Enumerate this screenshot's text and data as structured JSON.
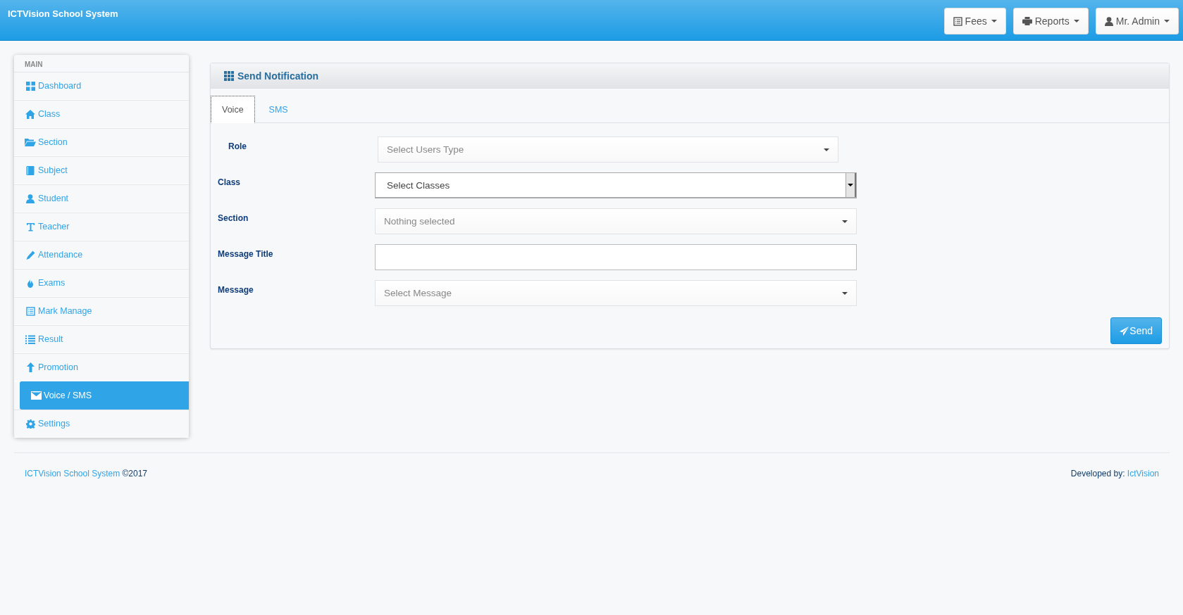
{
  "header": {
    "title": "ICTVision School System",
    "menus": [
      {
        "label": "Fees"
      },
      {
        "label": "Reports"
      },
      {
        "label": "Mr. Admin"
      }
    ]
  },
  "sidebar": {
    "heading": "MAIN",
    "items": [
      {
        "label": "Dashboard",
        "selected": false
      },
      {
        "label": "Class",
        "selected": false
      },
      {
        "label": "Section",
        "selected": false
      },
      {
        "label": "Subject",
        "selected": false
      },
      {
        "label": "Student",
        "selected": false
      },
      {
        "label": "Teacher",
        "selected": false
      },
      {
        "label": "Attendance",
        "selected": false
      },
      {
        "label": "Exams",
        "selected": false
      },
      {
        "label": "Mark Manage",
        "selected": false
      },
      {
        "label": "Result",
        "selected": false
      },
      {
        "label": "Promotion",
        "selected": false
      },
      {
        "label": "Voice / SMS",
        "selected": true
      },
      {
        "label": "Settings",
        "selected": false
      }
    ]
  },
  "panel": {
    "title": "Send Notification",
    "tabs": [
      {
        "label": "Voice",
        "selected": true
      },
      {
        "label": "SMS",
        "selected": false
      }
    ],
    "fields": [
      {
        "label": "Role",
        "kind": "dropdown",
        "placeholder": "Select Users Type"
      },
      {
        "label": "Class",
        "kind": "native-select",
        "value": "Select Classes"
      },
      {
        "label": "Section",
        "kind": "dropdown",
        "placeholder": "Nothing selected"
      },
      {
        "label": "Message Title",
        "kind": "text"
      },
      {
        "label": "Message",
        "kind": "dropdown",
        "placeholder": "Select Message"
      }
    ],
    "send_button": "Send"
  },
  "footer": {
    "link": "ICTVision School System",
    "copyright": "©2017",
    "credit": "Developed by:",
    "credit_link": "IctVision"
  }
}
